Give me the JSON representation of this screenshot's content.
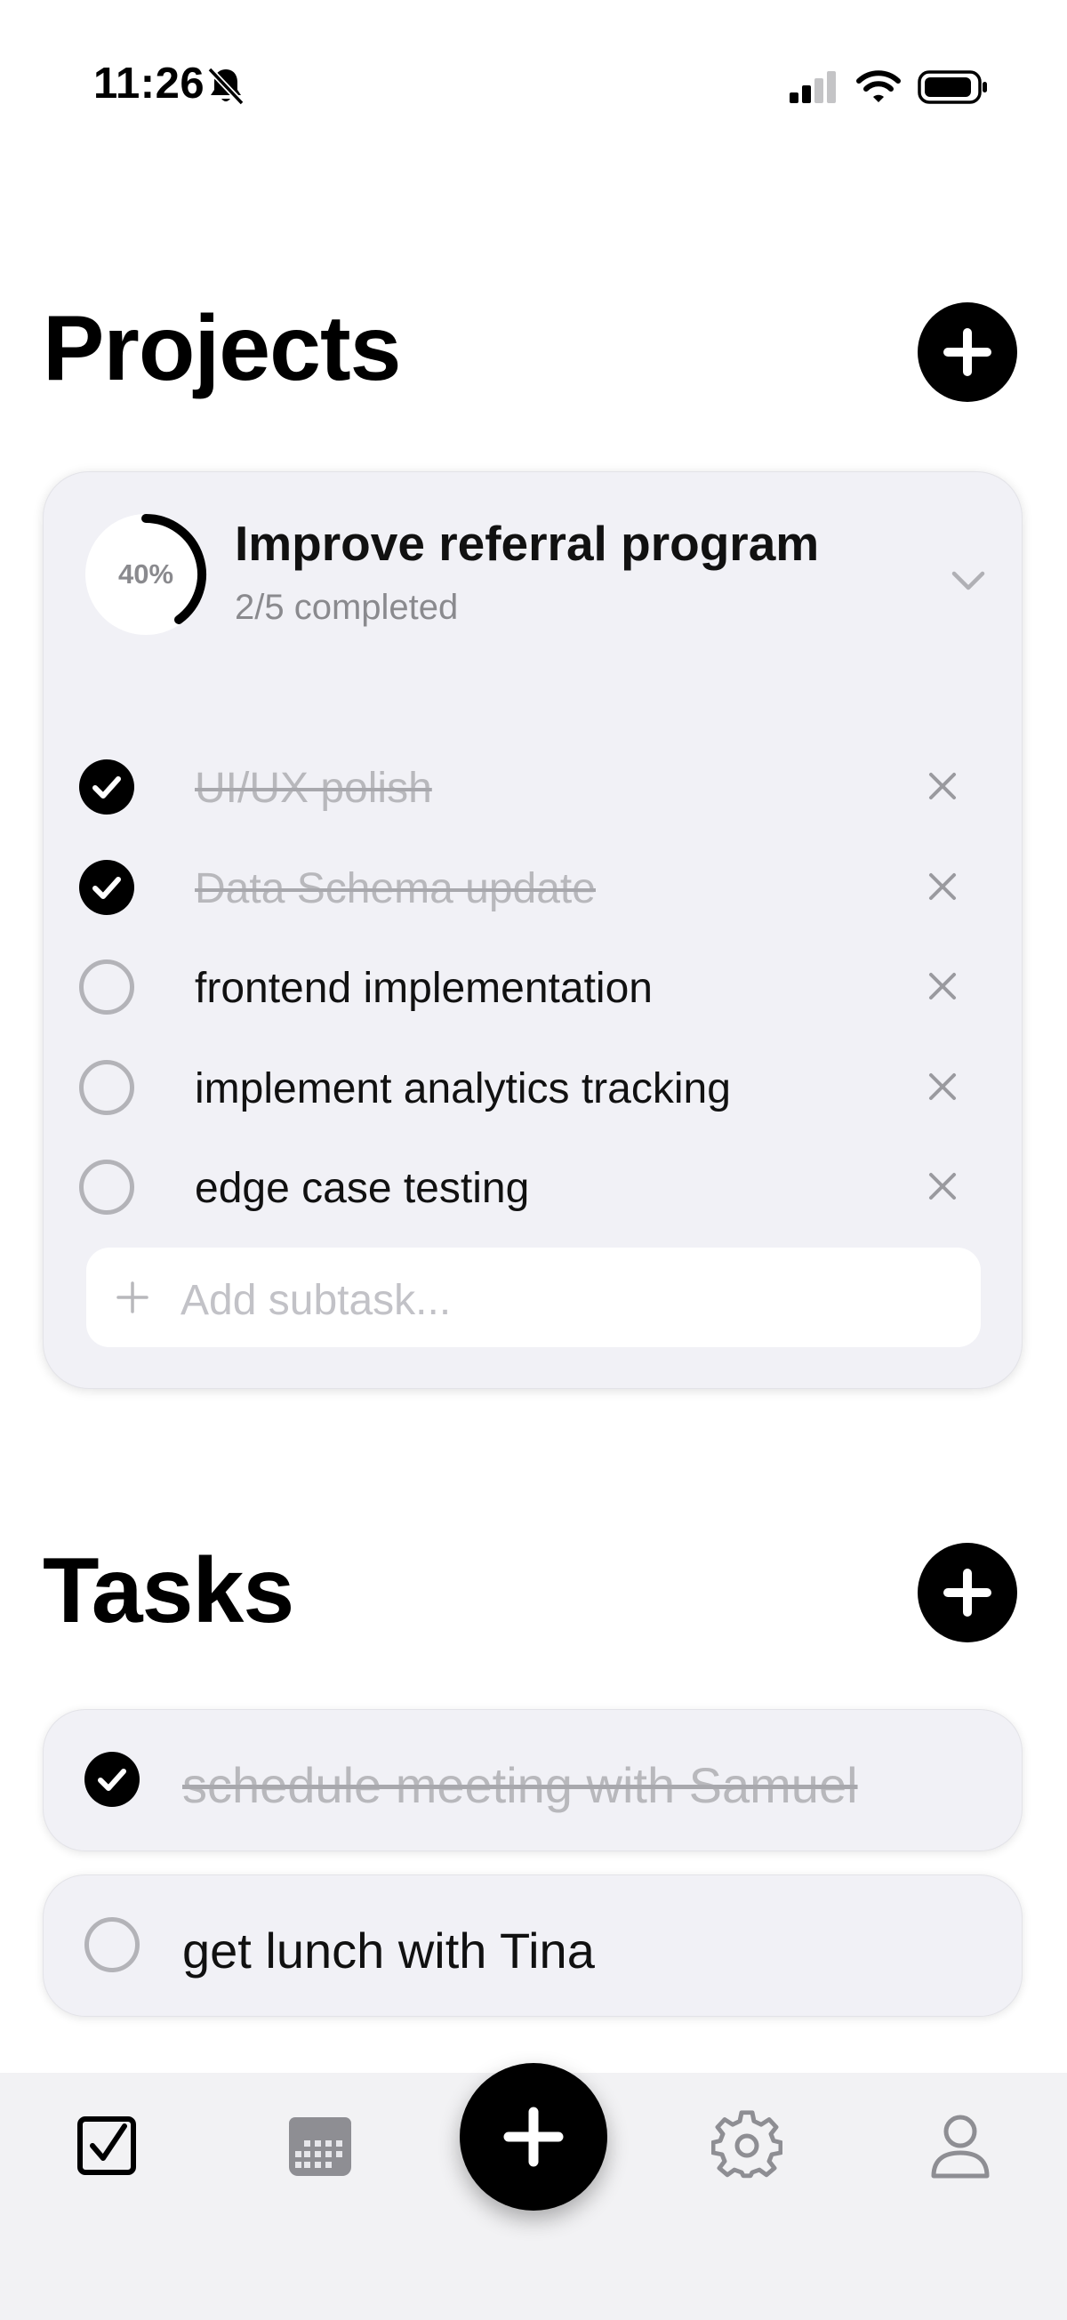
{
  "status_bar": {
    "time": "11:26",
    "icons": [
      "bell-slash-icon",
      "cellular-signal-icon",
      "wifi-icon",
      "battery-icon"
    ]
  },
  "projects": {
    "title": "Projects",
    "add_icon": "plus-circle-icon",
    "items": [
      {
        "progress_label": "40%",
        "progress_fraction": 0.4,
        "name": "Improve referral program",
        "summary": "2/5 completed",
        "expanded": true,
        "subtasks": [
          {
            "label": "UI/UX polish",
            "done": true
          },
          {
            "label": "Data Schema update",
            "done": true
          },
          {
            "label": "frontend implementation",
            "done": false
          },
          {
            "label": "implement analytics tracking",
            "done": false
          },
          {
            "label": "edge case testing",
            "done": false
          }
        ],
        "add_subtask_placeholder": "Add subtask..."
      }
    ]
  },
  "tasks": {
    "title": "Tasks",
    "add_icon": "plus-circle-icon",
    "items": [
      {
        "label": "schedule meeting with Samuel",
        "done": true
      },
      {
        "label": "get lunch with Tina",
        "done": false
      }
    ]
  },
  "tab_bar": {
    "items": [
      "checkbox-icon",
      "calendar-icon",
      "add-icon",
      "gear-icon",
      "person-icon"
    ],
    "active": "checkbox-icon"
  },
  "colors": {
    "accent": "#000000",
    "card_background": "#f1f1f6",
    "muted_text": "#8a8a8e",
    "tab_bar_background": "#f2f2f4"
  }
}
